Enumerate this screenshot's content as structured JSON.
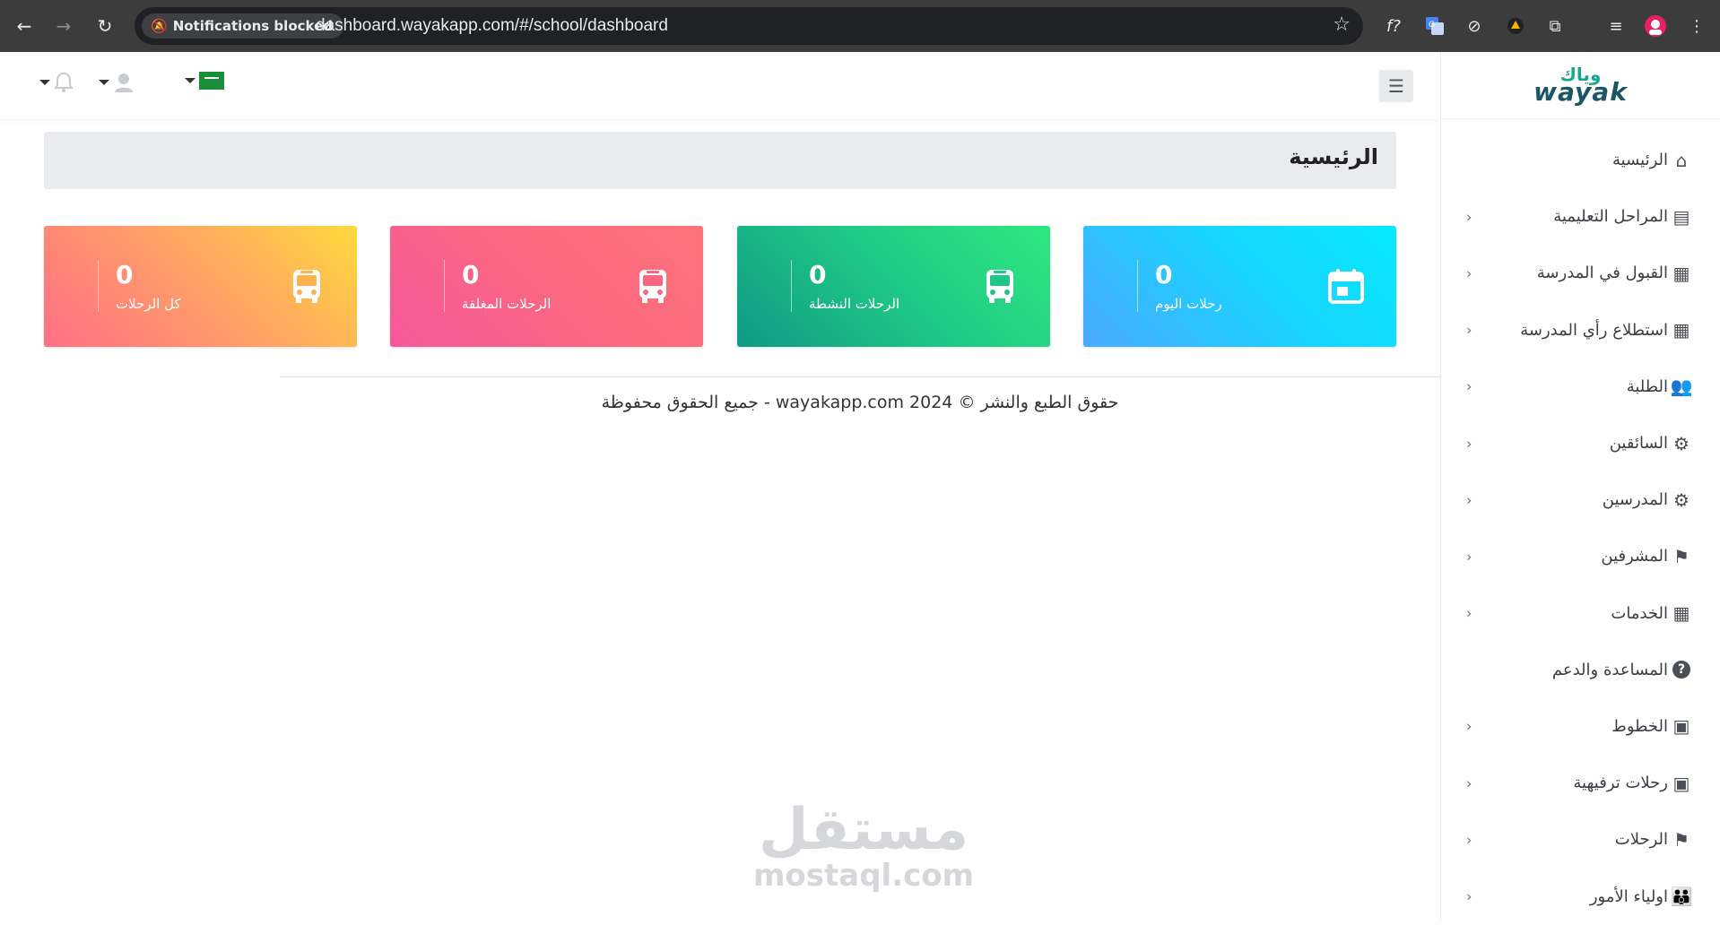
{
  "browser": {
    "notification_chip": "Notifications blocked",
    "url": "dashboard.wayakapp.com/#/school/dashboard"
  },
  "brand": {
    "arabic": "وياك",
    "english": "wayak"
  },
  "page": {
    "title": "الرئيسية"
  },
  "cards": [
    {
      "count": "0",
      "label": "رحلات اليوم",
      "icon": "calendar-icon"
    },
    {
      "count": "0",
      "label": "الرحلات النشطة",
      "icon": "bus-icon"
    },
    {
      "count": "0",
      "label": "الرحلات المغلقة",
      "icon": "bus-icon"
    },
    {
      "count": "0",
      "label": "كل الرحلات",
      "icon": "bus-icon"
    }
  ],
  "sidebar": {
    "items": [
      {
        "label": "الرئيسية",
        "icon": "home-icon",
        "has_chevron": false
      },
      {
        "label": "المراحل التعليمية",
        "icon": "id-card-icon",
        "has_chevron": true
      },
      {
        "label": "القبول في المدرسة",
        "icon": "document-icon",
        "has_chevron": true
      },
      {
        "label": "استطلاع رأي المدرسة",
        "icon": "document-icon",
        "has_chevron": true
      },
      {
        "label": "الطلبة",
        "icon": "users-icon",
        "has_chevron": true
      },
      {
        "label": "السائقين",
        "icon": "user-gear-icon",
        "has_chevron": true
      },
      {
        "label": "المدرسين",
        "icon": "user-gear-icon",
        "has_chevron": true
      },
      {
        "label": "المشرفين",
        "icon": "supervisor-icon",
        "has_chevron": true
      },
      {
        "label": "الخدمات",
        "icon": "document-icon",
        "has_chevron": true
      },
      {
        "label": "المساعدة والدعم",
        "icon": "help-icon",
        "has_chevron": false
      },
      {
        "label": "الخطوط",
        "icon": "bus-icon",
        "has_chevron": true
      },
      {
        "label": "رحلات ترفيهية",
        "icon": "bus-icon",
        "has_chevron": true
      },
      {
        "label": "الرحلات",
        "icon": "flag-icon",
        "has_chevron": true
      },
      {
        "label": "اولياء الأمور",
        "icon": "family-icon",
        "has_chevron": true
      }
    ]
  },
  "footer": {
    "text": "حقوق الطبع والنشر © 2024 wayakapp.com - جميع الحقوق محفوظة"
  },
  "watermark": {
    "arabic": "مستقل",
    "english": "mostaql.com"
  }
}
